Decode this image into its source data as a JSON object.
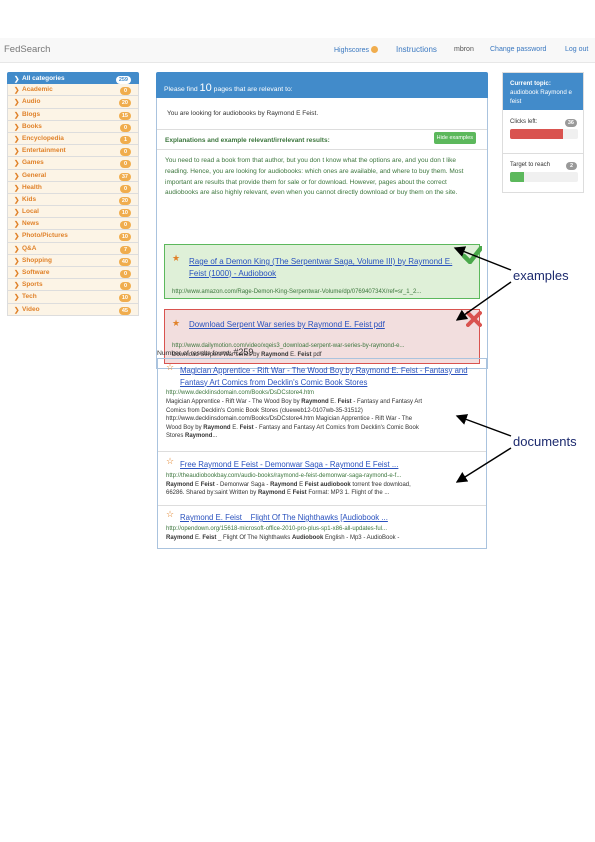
{
  "nav": {
    "brand": "FedSearch",
    "highscores": "Highscores",
    "instructions": "Instructions",
    "user": "mbron",
    "change_password": "Change password",
    "logout": "Log out"
  },
  "sidebar": {
    "items": [
      {
        "label": "All categories",
        "count": "259",
        "active": true
      },
      {
        "label": "Academic",
        "count": "0"
      },
      {
        "label": "Audio",
        "count": "20"
      },
      {
        "label": "Blogs",
        "count": "15"
      },
      {
        "label": "Books",
        "count": "0"
      },
      {
        "label": "Encyclopedia",
        "count": "1"
      },
      {
        "label": "Entertainment",
        "count": "0"
      },
      {
        "label": "Games",
        "count": "0"
      },
      {
        "label": "General",
        "count": "37"
      },
      {
        "label": "Health",
        "count": "0"
      },
      {
        "label": "Kids",
        "count": "20"
      },
      {
        "label": "Local",
        "count": "10"
      },
      {
        "label": "News",
        "count": "0"
      },
      {
        "label": "Photo/Pictures",
        "count": "10"
      },
      {
        "label": "Q&A",
        "count": "7"
      },
      {
        "label": "Shopping",
        "count": "40"
      },
      {
        "label": "Software",
        "count": "0"
      },
      {
        "label": "Sports",
        "count": "0"
      },
      {
        "label": "Tech",
        "count": "10"
      },
      {
        "label": "Video",
        "count": "45"
      }
    ]
  },
  "task": {
    "header_pre": "Please find",
    "header_num": "10",
    "header_post": "pages that are relevant to:",
    "looking_for": "You are looking for audiobooks by Raymond E Feist.",
    "explanations_title": "Explanations and example relevant/irrelevant results:",
    "hide_examples": "Hide examples",
    "paragraph": "You need to read a book from that author, but you don t know what the options are, and you don t like reading. Hence, you are looking for audiobooks: which ones are available, and where to buy them. Most important are results that provide them for sale or for download. However, pages about the correct audiobooks are also highly relevant, even when you cannot directly download or buy them on the site."
  },
  "examples": [
    {
      "title": "Rage of a Demon King (The Serpentwar Saga, Volume III) by Raymond E. Feist (1000) - Audiobook",
      "url": "http://www.amazon.com/Rage-Demon-King-Serpentwar-Volume/dp/076940734X/ref=sr_1_2...",
      "snippet": "",
      "verdict": "relevant"
    },
    {
      "title": "Download Serpent War series by Raymond E. Feist pdf",
      "url": "http://www.dailymotion.com/video/xqeis3_download-serpent-war-series-by-raymond-e...",
      "snippet_parts": [
        "Download Serpent War series by ",
        "Raymond",
        " E. ",
        "Feist",
        " pdf"
      ],
      "verdict": "irrelevant"
    }
  ],
  "results_count_label": "Number of results found:",
  "results_count": "#259",
  "results": [
    {
      "title": "Magician Apprentice - Rift War - The Wood Boy by Raymond E. Feist - Fantasy and Fantasy Art Comics from Decklin's Comic Book Stores",
      "url": "http://www.decklinsdomain.com/Books/DsDCstore4.htm",
      "snippet_lines": [
        [
          "Magician Apprentice - Rift War - The Wood Boy by ",
          "Raymond",
          " E. ",
          "Feist",
          " - Fantasy and Fantasy Art"
        ],
        [
          "Comics from Decklin's Comic Book Stores (clueweb12-0107wb-35-31512)"
        ],
        [
          "http://www.decklinsdomain.com/Books/DsDCstore4.htm Magician Apprentice - Rift War - The"
        ],
        [
          "Wood Boy by ",
          "Raymond",
          " E. ",
          "Feist",
          " - Fantasy and Fantasy Art Comics from Decklin's Comic Book"
        ],
        [
          "Stores ",
          "Raymond",
          "..."
        ]
      ]
    },
    {
      "title": "Free Raymond E Feist - Demonwar Saga - Raymond E Feist ...",
      "url": "http://theaudiobookbay.com/audio-books/raymond-e-feist-demonwar-saga-raymond-e-f...",
      "snippet_lines": [
        [
          "Raymond",
          " E ",
          "Feist",
          " - Demonwar Saga - ",
          "Raymond",
          " E ",
          "Feist audiobook",
          " torrent free download,"
        ],
        [
          "66286. Shared by:saint Written by ",
          "Raymond",
          " E ",
          "Feist",
          " Format: MP3 1. Flight of the ..."
        ]
      ]
    },
    {
      "title": "Raymond E. Feist _ Flight Of The Nighthawks [Audiobook ...",
      "url": "http://opendown.org/15618-microsoft-office-2010-pro-plus-sp1-x86-all-updates-ful...",
      "snippet_lines": [
        [
          "Raymond",
          " E. ",
          "Feist",
          " _ Flight Of The Nighthawks ",
          "Audiobook",
          " English - Mp3 - AudioBook -"
        ]
      ]
    }
  ],
  "status": {
    "current_topic_label": "Current topic:",
    "current_topic": "audiobook Raymond e feist",
    "clicks_left_label": "Clicks left:",
    "clicks_left": "36",
    "clicks_left_fraction": 0.78,
    "target_label": "Target to reach",
    "target_value": "2",
    "target_fraction": 0.2
  },
  "annotations": {
    "examples": "examples",
    "documents": "documents"
  },
  "colors": {
    "primary": "#428bca",
    "category": "#e0822a",
    "relevant": "#5cb85c",
    "irrelevant": "#d9534f"
  }
}
